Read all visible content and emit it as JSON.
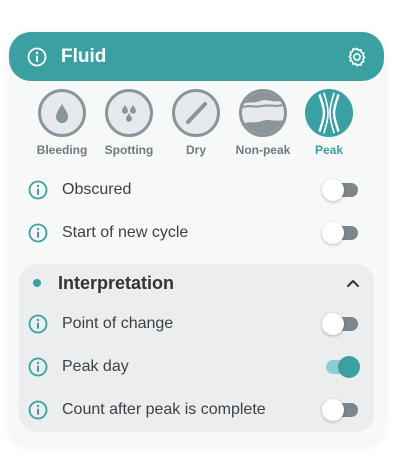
{
  "header": {
    "title": "Fluid",
    "info_icon": "info-icon",
    "settings_icon": "gear-icon"
  },
  "fluid_types": [
    {
      "label": "Bleeding",
      "icon": "drop-icon",
      "selected": false
    },
    {
      "label": "Spotting",
      "icon": "spotting-icon",
      "selected": false
    },
    {
      "label": "Dry",
      "icon": "dry-slash-icon",
      "selected": false
    },
    {
      "label": "Non-peak",
      "icon": "non-peak-icon",
      "selected": false
    },
    {
      "label": "Peak",
      "icon": "peak-icon",
      "selected": true
    }
  ],
  "options": [
    {
      "label": "Obscured",
      "on": false
    },
    {
      "label": "Start of new cycle",
      "on": false
    }
  ],
  "interpretation": {
    "title": "Interpretation",
    "expanded": true,
    "items": [
      {
        "label": "Point of change",
        "on": false
      },
      {
        "label": "Peak day",
        "on": true
      },
      {
        "label": "Count after peak is complete",
        "on": false
      }
    ]
  },
  "colors": {
    "accent": "#3aa0a1",
    "icon_grey": "#8a959b",
    "card_bg": "#f7f8f8",
    "section_bg": "#ebedee"
  }
}
